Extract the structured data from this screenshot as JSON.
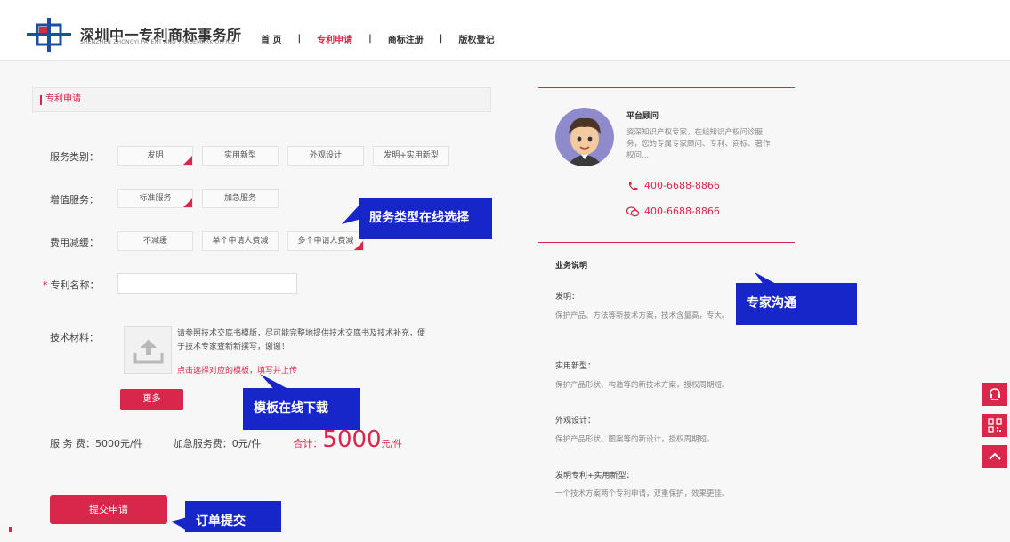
{
  "header": {
    "logo_cn": "深圳中一专利商标事务所",
    "logo_en": "SHENZHEN ZHONGYI PATENT AND TRADEMARK OFFICE",
    "nav": [
      {
        "label": "首 页",
        "active": false
      },
      {
        "label": "专利申请",
        "active": true
      },
      {
        "label": "商标注册",
        "active": false
      },
      {
        "label": "版权登记",
        "active": false
      }
    ],
    "separator": "|"
  },
  "form": {
    "panel_title": "专利申请",
    "service_type": {
      "label": "服务类别：",
      "options": [
        "发明",
        "实用新型",
        "外观设计",
        "发明+实用新型"
      ],
      "selected": "发明"
    },
    "value_added": {
      "label": "增值服务：",
      "options": [
        "标准服务",
        "加急服务"
      ],
      "selected": "标准服务"
    },
    "fee_reduction": {
      "label": "费用减缓：",
      "options": [
        "不减缓",
        "单个申请人费减",
        "多个申请人费减"
      ],
      "selected": "多个申请人费减"
    },
    "patent_name": {
      "label": "专利名称：",
      "required_mark": "*",
      "value": "",
      "placeholder": ""
    },
    "tech_material": {
      "label": "技术材料：",
      "hint": "请参照技术交底书模版，尽可能完整地提供技术交底书及技术补充，便于技术专家查新新撰写，谢谢！",
      "link": "点击选择对应的模板，填写并上传",
      "more_button": "更多"
    },
    "fees": {
      "service_fee": "服 务 费：5000元/件",
      "urgent_fee": "加急服务费：0元/件",
      "total_label": "合计：",
      "total_value": "5000",
      "total_unit": "元/件"
    },
    "submit_button": "提交申请"
  },
  "callouts": {
    "service_select": "服务类型在线选择",
    "template_download": "模板在线下载",
    "order_submit": "订单提交",
    "expert_chat": "专家沟通"
  },
  "advisor": {
    "title": "平台顾问",
    "desc": "资深知识产权专家，在线知识产权问诊服务，您的专属专家顾问、专利、商标、著作权问...",
    "phone": "400-6688-8866",
    "wechat": "400-6688-8866"
  },
  "business": {
    "heading": "业务说明",
    "items": [
      {
        "title": "发明：",
        "desc": "保护产品、方法等新技术方案，技术含量高，专大。"
      },
      {
        "title": "实用新型：",
        "desc": "保护产品形状、构造等的新技术方案，授权周期短。"
      },
      {
        "title": "外观设计：",
        "desc": "保护产品形状、图案等的新设计，授权周期短。"
      },
      {
        "title": "发明专利+实用新型：",
        "desc": "一个技术方案两个专利申请，双重保护，效果更佳。"
      }
    ]
  },
  "colors": {
    "accent": "#d8274b",
    "callout": "#1726c9",
    "logo_blue": "#1b4f9c"
  }
}
